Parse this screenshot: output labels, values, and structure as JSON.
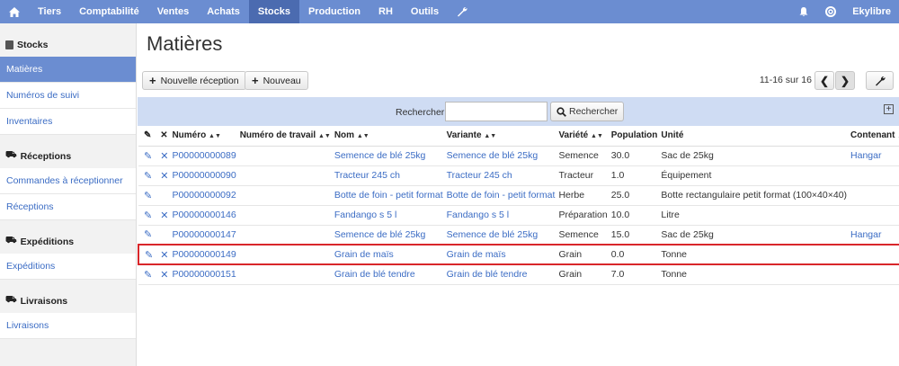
{
  "topnav": {
    "items": [
      "Tiers",
      "Comptabilité",
      "Ventes",
      "Achats",
      "Stocks",
      "Production",
      "RH",
      "Outils"
    ],
    "active": "Stocks",
    "user": "Ekylibre"
  },
  "sidebar": {
    "sections": [
      {
        "title": "Stocks",
        "items": [
          "Matières",
          "Numéros de suivi",
          "Inventaires"
        ]
      },
      {
        "title": "Réceptions",
        "items": [
          "Commandes à réceptionner",
          "Réceptions"
        ]
      },
      {
        "title": "Expéditions",
        "items": [
          "Expéditions"
        ]
      },
      {
        "title": "Livraisons",
        "items": [
          "Livraisons"
        ]
      }
    ]
  },
  "page": {
    "title": "Matières",
    "new_reception": "Nouvelle réception",
    "new": "Nouveau",
    "pager": "11-16 sur 16"
  },
  "search": {
    "label": "Rechercher",
    "button": "Rechercher"
  },
  "table": {
    "headers": [
      "Numéro",
      "Numéro de travail",
      "Nom",
      "Variante",
      "Variété",
      "Population",
      "Unité",
      "Contenant"
    ],
    "rows": [
      {
        "numero": "P00000000089",
        "nom": "Semence de blé 25kg",
        "variante": "Semence de blé 25kg",
        "variete": "Semence",
        "population": "30.0",
        "unite": "Sac de 25kg",
        "contenant": "Hangar",
        "deletable": true
      },
      {
        "numero": "P00000000090",
        "nom": "Tracteur 245 ch",
        "variante": "Tracteur 245 ch",
        "variete": "Tracteur",
        "population": "1.0",
        "unite": "Équipement",
        "contenant": "",
        "deletable": true
      },
      {
        "numero": "P00000000092",
        "nom": "Botte de foin - petit format",
        "variante": "Botte de foin - petit format",
        "variete": "Herbe",
        "population": "25.0",
        "unite": "Botte rectangulaire petit format (100×40×40)",
        "contenant": "",
        "deletable": false
      },
      {
        "numero": "P00000000146",
        "nom": "Fandango s 5 l",
        "variante": "Fandango s 5 l",
        "variete": "Préparation",
        "population": "10.0",
        "unite": "Litre",
        "contenant": "",
        "deletable": true
      },
      {
        "numero": "P00000000147",
        "nom": "Semence de blé 25kg",
        "variante": "Semence de blé 25kg",
        "variete": "Semence",
        "population": "15.0",
        "unite": "Sac de 25kg",
        "contenant": "Hangar",
        "deletable": false
      },
      {
        "numero": "P00000000149",
        "nom": "Grain de maïs",
        "variante": "Grain de maïs",
        "variete": "Grain",
        "population": "0.0",
        "unite": "Tonne",
        "contenant": "",
        "deletable": true
      },
      {
        "numero": "P00000000151",
        "nom": "Grain de blé tendre",
        "variante": "Grain de blé tendre",
        "variete": "Grain",
        "population": "7.0",
        "unite": "Tonne",
        "contenant": "",
        "deletable": true
      }
    ]
  }
}
